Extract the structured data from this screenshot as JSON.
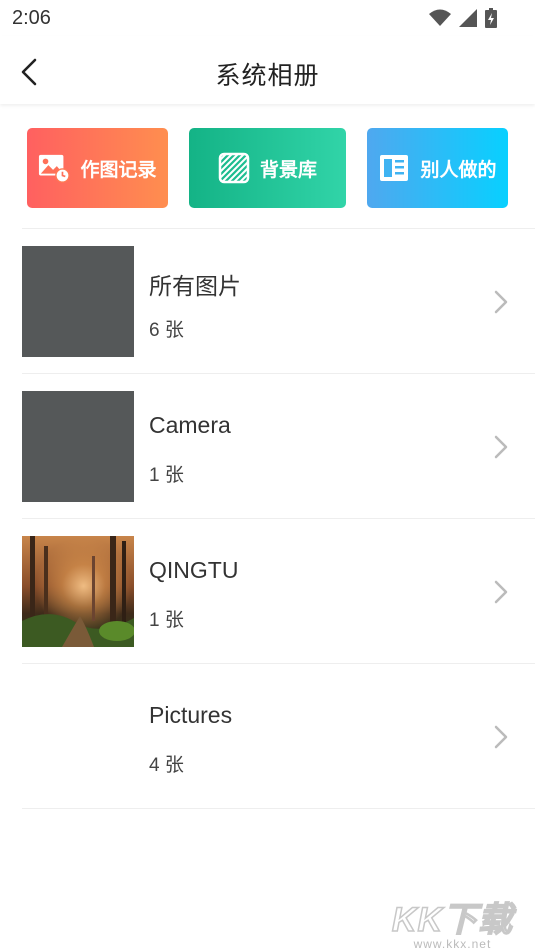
{
  "status": {
    "time": "2:06"
  },
  "header": {
    "title": "系统相册"
  },
  "shortcuts": [
    {
      "label": "作图记录",
      "icon": "image-history-icon"
    },
    {
      "label": "背景库",
      "icon": "pattern-icon"
    },
    {
      "label": "别人做的",
      "icon": "layout-icon"
    }
  ],
  "albums": [
    {
      "name": "所有图片",
      "count": "6 张"
    },
    {
      "name": "Camera",
      "count": "1 张"
    },
    {
      "name": "QINGTU",
      "count": "1 张"
    },
    {
      "name": "Pictures",
      "count": "4 张"
    }
  ],
  "watermark": {
    "main": "KK下载",
    "sub": "www.kkx.net"
  }
}
